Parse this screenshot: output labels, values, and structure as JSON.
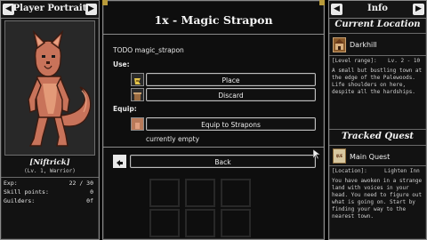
{
  "left_panel": {
    "title": "Player Portrait",
    "prev_glyph": "◀",
    "next_glyph": "▶",
    "player_name": "[Niftrick]",
    "player_sub": "(Lv. 1, Warrior)",
    "stats": [
      {
        "label": "Exp:",
        "value": "22 / 30"
      },
      {
        "label": "Skill points:",
        "value": "0"
      },
      {
        "label": "Guilders:",
        "value": "0f"
      }
    ]
  },
  "dialog": {
    "title": "1x - Magic Strapon",
    "description": "TODO magic_strapon",
    "use_label": "Use:",
    "place_label": "Place",
    "discard_label": "Discard",
    "equip_label": "Equip:",
    "equip_button_label": "Equip to Strapons",
    "equip_status": "currently empty",
    "back_label": "Back"
  },
  "right_panel": {
    "title": "Info",
    "current_location_heading": "Current Location",
    "location_name": "Darkhill",
    "level_range_label": "[Level range]:",
    "level_range_value": "Lv. 2 - 10",
    "location_desc": "A small but bustling town at the edge of the Palewoods. Life shoulders on here, despite all the hardships.",
    "tracked_quest_heading": "Tracked Quest",
    "quest_name": "Main Quest",
    "quest_location_label": "[Location]:",
    "quest_location_value": "Lighten Inn",
    "quest_desc": "You have awoken in a strange land with voices in your head. You need to figure out what is going on. Start by finding your way to the nearest town.",
    "quest_icon_text": "QUE"
  },
  "colors": {
    "accent_gold": "#b89a3a",
    "fur": "#c8735a"
  }
}
